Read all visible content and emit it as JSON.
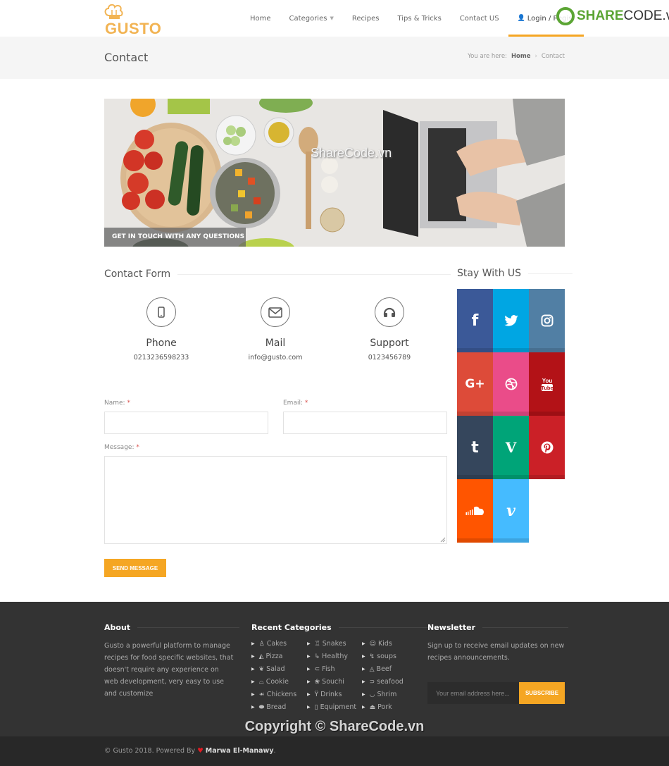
{
  "header": {
    "logo_text": "GUSTO",
    "nav": [
      {
        "label": "Home"
      },
      {
        "label": "Categories",
        "has_dropdown": true
      },
      {
        "label": "Recipes"
      },
      {
        "label": "Tips & Tricks"
      },
      {
        "label": "Contact US"
      },
      {
        "label": "Login / Regist",
        "icon": "user-icon",
        "active": true
      }
    ],
    "accent": "#f5a623",
    "watermark": {
      "bold": "SHARE",
      "rest": "CODE.vn"
    }
  },
  "titlebar": {
    "title": "Contact",
    "breadcrumb": {
      "prefix": "You are here:",
      "home": "Home",
      "sep": "›",
      "current": "Contact"
    }
  },
  "hero": {
    "caption": "GET IN TOUCH WITH ANY QUESTIONS",
    "watermark": "ShareCode.vn"
  },
  "contact": {
    "section_title": "Contact Form",
    "info": [
      {
        "icon": "mobile-phone-icon",
        "label": "Phone",
        "value": "0213236598233"
      },
      {
        "icon": "envelope-icon",
        "label": "Mail",
        "value": "info@gusto.com"
      },
      {
        "icon": "headphones-icon",
        "label": "Support",
        "value": "0123456789"
      }
    ],
    "form": {
      "name_label": "Name:",
      "email_label": "Email:",
      "message_label": "Message:",
      "required_mark": "*",
      "name_value": "",
      "email_value": "",
      "message_value": "",
      "submit_label": "SEND MESSAGE"
    }
  },
  "social": {
    "section_title": "Stay With US",
    "tiles": [
      {
        "name": "facebook",
        "glyph": "f",
        "color": "#3b5998"
      },
      {
        "name": "twitter",
        "glyph": "🐦",
        "color": "#00a6e3"
      },
      {
        "name": "instagram",
        "glyph": "◎",
        "color": "#517fa4"
      },
      {
        "name": "google-plus",
        "glyph": "G+",
        "color": "#dd4b39"
      },
      {
        "name": "dribbble",
        "glyph": "⊛",
        "color": "#ea4c89"
      },
      {
        "name": "youtube",
        "glyph": "You Tube",
        "color": "#b31217"
      },
      {
        "name": "tumblr",
        "glyph": "t",
        "color": "#35465c"
      },
      {
        "name": "vine",
        "glyph": "V",
        "color": "#00a478"
      },
      {
        "name": "pinterest",
        "glyph": "P",
        "color": "#cb2027"
      },
      {
        "name": "soundcloud",
        "glyph": "☁",
        "color": "#ff5500"
      },
      {
        "name": "vimeo",
        "glyph": "v",
        "color": "#45bbff"
      }
    ]
  },
  "footer": {
    "about": {
      "title": "About",
      "text": "Gusto a powerful platform to manage recipes for food specific websites, that doesn't require any experience on web development, very easy to use and customize"
    },
    "categories": {
      "title": "Recent Categories",
      "columns": [
        [
          {
            "icon": "cake-icon",
            "glyph": "♙",
            "label": "Cakes"
          },
          {
            "icon": "pizza-icon",
            "glyph": "◭",
            "label": "Pizza"
          },
          {
            "icon": "salad-icon",
            "glyph": "❦",
            "label": "Salad"
          },
          {
            "icon": "cookie-icon",
            "glyph": "⌓",
            "label": "Cookie"
          },
          {
            "icon": "chicken-icon",
            "glyph": "☙",
            "label": "Chickens"
          },
          {
            "icon": "bread-icon",
            "glyph": "⬬",
            "label": "Bread"
          }
        ],
        [
          {
            "icon": "snacks-icon",
            "glyph": "♖",
            "label": "Snakes"
          },
          {
            "icon": "healthy-icon",
            "glyph": "↳",
            "label": "Healthy"
          },
          {
            "icon": "fish-icon",
            "glyph": "⊂",
            "label": "Fish"
          },
          {
            "icon": "sushi-icon",
            "glyph": "❀",
            "label": "Souchi"
          },
          {
            "icon": "drinks-icon",
            "glyph": "Ÿ",
            "label": "Drinks"
          },
          {
            "icon": "equipment-icon",
            "glyph": "▯",
            "label": "Equipment"
          }
        ],
        [
          {
            "icon": "kids-icon",
            "glyph": "☺",
            "label": "Kids"
          },
          {
            "icon": "soups-icon",
            "glyph": "↯",
            "label": "soups"
          },
          {
            "icon": "beef-icon",
            "glyph": "◬",
            "label": "Beef"
          },
          {
            "icon": "seafood-icon",
            "glyph": "⊃",
            "label": "seafood"
          },
          {
            "icon": "shrimp-icon",
            "glyph": "◡",
            "label": "Shrim"
          },
          {
            "icon": "pork-icon",
            "glyph": "⏏",
            "label": "Pork"
          }
        ]
      ]
    },
    "newsletter": {
      "title": "Newsletter",
      "text": "Sign up to receive email updates on new recipes announcements.",
      "placeholder": "Your email address here...",
      "value": "",
      "button": "SUBSCRIBE"
    },
    "watermark": "Copyright © ShareCode.vn",
    "bottom": {
      "prefix": "© Gusto 2018. Powered By",
      "heart": "♥",
      "author": "Marwa El-Manawy",
      "suffix": "."
    }
  }
}
